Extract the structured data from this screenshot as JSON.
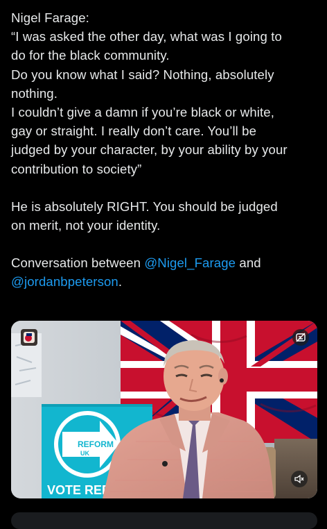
{
  "tweet": {
    "lines": [
      "Nigel Farage:",
      "“I was asked the other day, what was I going to",
      "do for the black community.",
      "Do you know what I said? Nothing, absolutely",
      "nothing.",
      "I couldn’t give a damn if you’re black or white,",
      "gay or straight. I really don’t care. You’ll be",
      "judged by your character, by your ability by your",
      "contribution to society”"
    ],
    "opinion_lines": [
      "He is absolutely RIGHT. You should be judged",
      "on merit, not your identity."
    ],
    "conversation_prefix": "Conversation between",
    "mention_1": "@Nigel_Farage",
    "conversation_and": "and",
    "mention_2": "@jordanbpeterson",
    "conversation_end": "."
  },
  "media": {
    "sign_brand": "REFORM",
    "sign_brand_sub": "UK",
    "sign_text": "VOTE REF",
    "icons": [
      "channel-avatar-icon",
      "captions-icon",
      "mute-icon"
    ]
  },
  "colors": {
    "background": "#000000",
    "text": "#e7e9ea",
    "mention": "#1d9bf0",
    "reform_blue": "#12b6cf",
    "flag_red": "#c8102e",
    "flag_blue": "#012169"
  }
}
